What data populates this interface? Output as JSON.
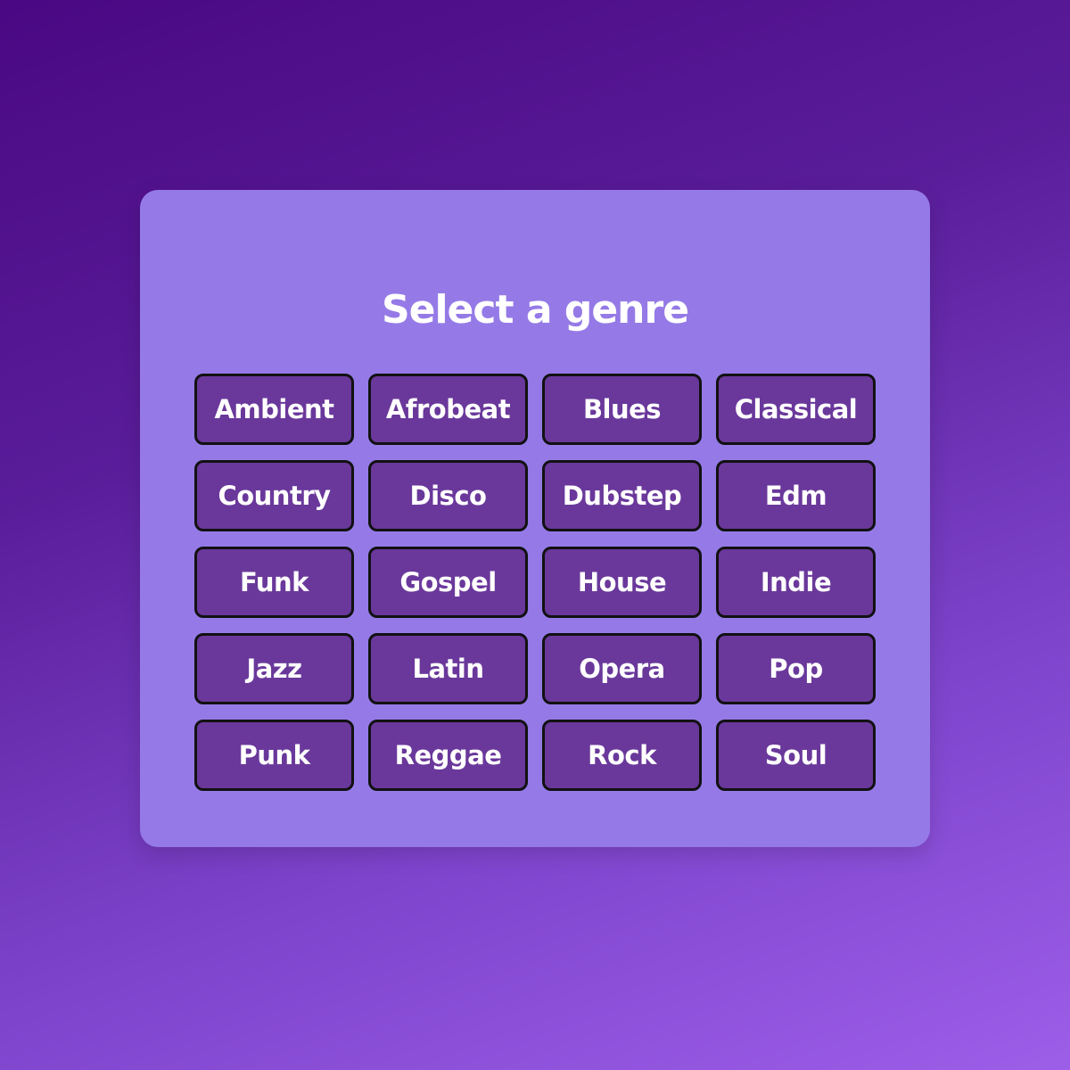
{
  "title": "Select a genre",
  "genres": [
    "Ambient",
    "Afrobeat",
    "Blues",
    "Classical",
    "Country",
    "Disco",
    "Dubstep",
    "Edm",
    "Funk",
    "Gospel",
    "House",
    "Indie",
    "Jazz",
    "Latin",
    "Opera",
    "Pop",
    "Punk",
    "Reggae",
    "Rock",
    "Soul"
  ],
  "colors": {
    "card": "#957ae7",
    "button": "#6a389b",
    "border": "#111111"
  }
}
